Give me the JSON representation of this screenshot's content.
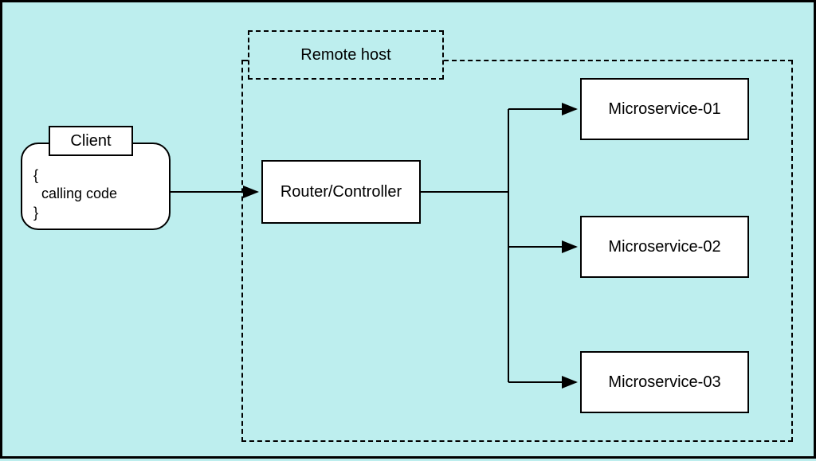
{
  "remote_host_label": "Remote host",
  "client": {
    "label": "Client",
    "code_open": "{",
    "code_body": "calling code",
    "code_close": "}"
  },
  "router": {
    "label": "Router/Controller"
  },
  "microservices": {
    "ms1": "Microservice-01",
    "ms2": "Microservice-02",
    "ms3": "Microservice-03"
  }
}
